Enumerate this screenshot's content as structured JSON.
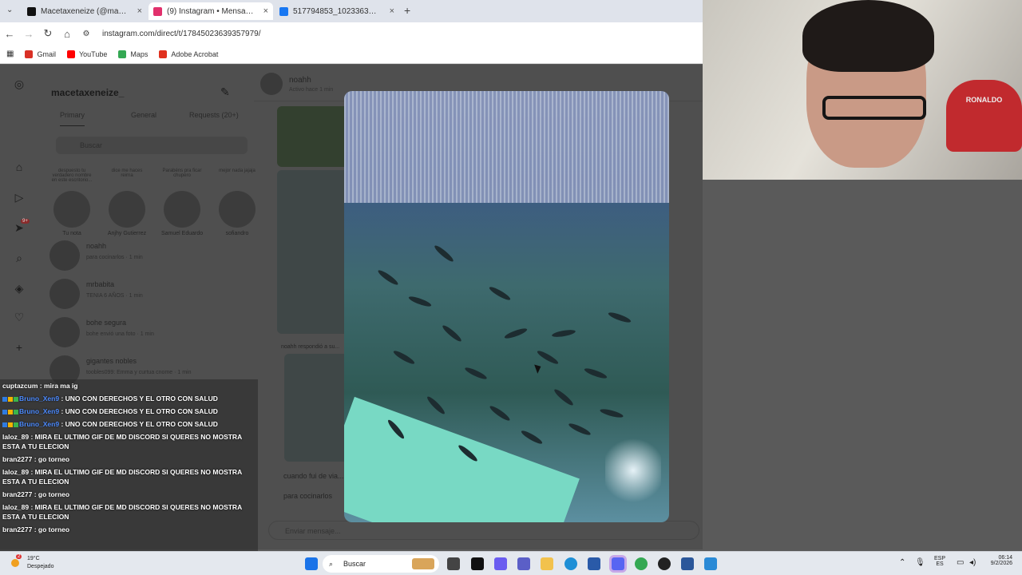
{
  "browser": {
    "tabs": [
      {
        "label": "Macetaxeneize (@macetaxenei...",
        "color": "#111111",
        "active": false
      },
      {
        "label": "(9) Instagram • Mensajes",
        "color": "#e1306c",
        "active": true
      },
      {
        "label": "517794853_1023363785814831...",
        "color": "#1877f2",
        "active": false
      }
    ],
    "new_tab": "+",
    "url": "instagram.com/direct/t/17845023639357979/",
    "bookmarks": [
      {
        "label": "Gmail",
        "color": "#d93025"
      },
      {
        "label": "YouTube",
        "color": "#ff0000"
      },
      {
        "label": "Maps",
        "color": "#34a853"
      },
      {
        "label": "Adobe Acrobat",
        "color": "#e0301e"
      }
    ]
  },
  "instagram": {
    "account": "macetaxeneize_",
    "filters": [
      "Primary",
      "General",
      "Requests (20+)"
    ],
    "search_placeholder": "Buscar",
    "notification_count": "9+",
    "stories": [
      {
        "note": "despuesto tu verdadero nombre en este escritorio...",
        "name": "Tu nota"
      },
      {
        "note": "dice me haces reirna",
        "name": "Anjhy Gutierrez"
      },
      {
        "note": "Parabéns pra ficar chupero",
        "name": "Samuel Eduardo"
      },
      {
        "note": "mejor nada jajaja",
        "name": "sofiandro"
      }
    ],
    "conversations": [
      {
        "name": "noahh",
        "preview": "para cocinarlos · 1 min"
      },
      {
        "name": "mrbabita",
        "preview": "TENIA 6 AÑOS · 1 min"
      },
      {
        "name": "bohe segura",
        "preview": "bohe envió una foto · 1 min"
      },
      {
        "name": "gigantes nobles",
        "preview": "toobles099: Emma y curtua cnome · 1 min"
      }
    ],
    "chat": {
      "name": "noahh",
      "status": "Activo hace 1 min",
      "reply_note": "noahh respondió a su...",
      "messages": [
        "cuando fui de via...",
        "para cocinarlos"
      ],
      "input_placeholder": "Enviar mensaje..."
    }
  },
  "stream_chat": [
    {
      "user": "cuptazcum",
      "msg": "mira ma ig",
      "blue": false
    },
    {
      "user": "Bruno_Xen9",
      "msg": "UNO CON DERECHOS Y EL OTRO CON SALUD",
      "blue": true
    },
    {
      "user": "Bruno_Xen9",
      "msg": "UNO CON DERECHOS Y EL OTRO CON SALUD",
      "blue": true
    },
    {
      "user": "Bruno_Xen9",
      "msg": "UNO CON DERECHOS Y EL OTRO CON SALUD",
      "blue": true
    },
    {
      "user": "laloz_89",
      "msg": "MIRA EL ULTIMO GIF DE MD DISCORD SI QUERES NO MOSTRA ESTA A TU ELECION",
      "blue": false
    },
    {
      "user": "bran2277",
      "msg": "go torneo",
      "blue": false
    },
    {
      "user": "laloz_89",
      "msg": "MIRA EL ULTIMO GIF DE MD DISCORD SI QUERES NO MOSTRA ESTA A TU ELECION",
      "blue": false
    },
    {
      "user": "bran2277",
      "msg": "go torneo",
      "blue": false
    },
    {
      "user": "laloz_89",
      "msg": "MIRA EL ULTIMO GIF DE MD DISCORD SI QUERES NO MOSTRA ESTA A TU ELECION",
      "blue": false
    },
    {
      "user": "bran2277",
      "msg": "go torneo",
      "blue": false
    }
  ],
  "webcam": {
    "cap_text": "RONALDO"
  },
  "taskbar": {
    "weather_temp": "19°C",
    "weather_desc": "Despejado",
    "weather_badge": "2",
    "search_label": "Buscar",
    "lang_top": "ESP",
    "lang_bottom": "ES",
    "time": "06:14",
    "date": "9/2/2026"
  }
}
